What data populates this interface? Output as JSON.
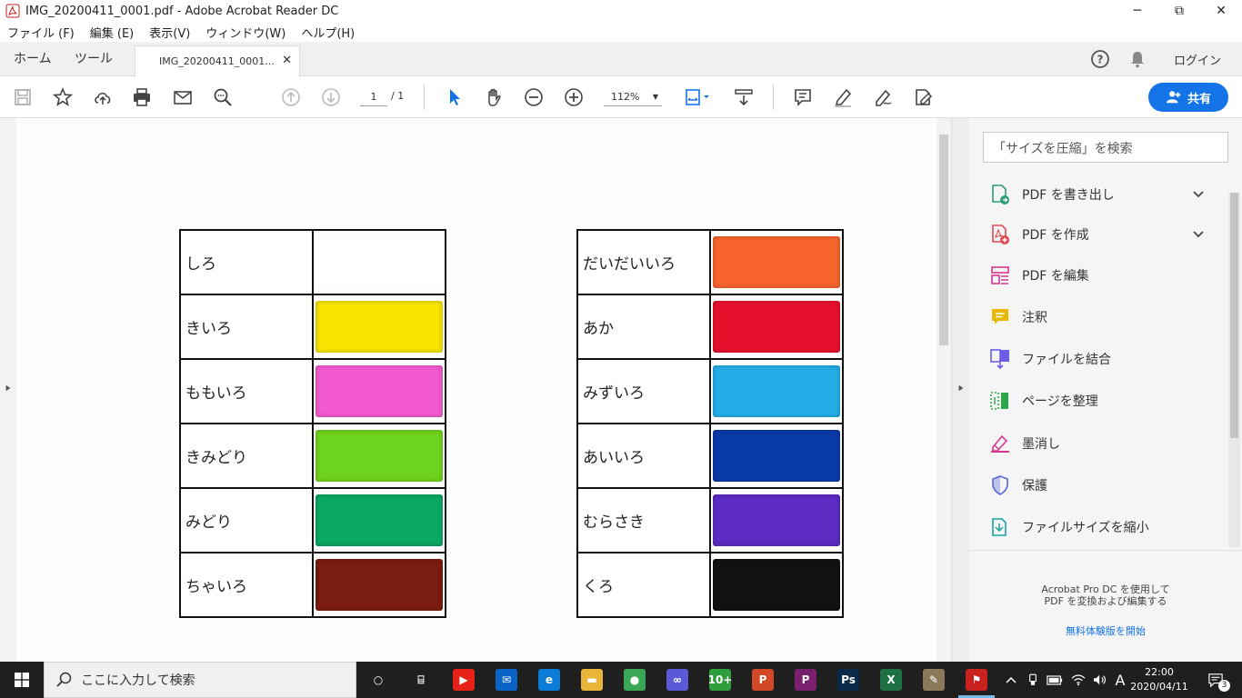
{
  "window": {
    "title": "IMG_20200411_0001.pdf - Adobe Acrobat Reader DC",
    "minimize": "─",
    "maximize": "⧉",
    "close": "✕"
  },
  "menu": [
    "ファイル (F)",
    "編集 (E)",
    "表示(V)",
    "ウィンドウ(W)",
    "ヘルプ(H)"
  ],
  "tabs": {
    "home": "ホーム",
    "tools": "ツール",
    "document": "IMG_20200411_0001...",
    "close": "✕",
    "login": "ログイン"
  },
  "toolbar": {
    "page_current": "1",
    "page_total": "/ 1",
    "zoom": "112%",
    "share_label": "共有"
  },
  "right_panel": {
    "search_placeholder": "「サイズを圧縮」を検索",
    "tools": [
      {
        "label": "PDF を書き出し",
        "icon": "export-pdf-icon",
        "color": "#2d9d78"
      },
      {
        "label": "PDF を作成",
        "icon": "create-pdf-icon",
        "color": "#e34850"
      },
      {
        "label": "PDF を編集",
        "icon": "edit-pdf-icon",
        "color": "#d83790"
      },
      {
        "label": "注釈",
        "icon": "comment-icon",
        "color": "#e8b900"
      },
      {
        "label": "ファイルを結合",
        "icon": "combine-files-icon",
        "color": "#6c5ce7"
      },
      {
        "label": "ページを整理",
        "icon": "organize-pages-icon",
        "color": "#2ba84a"
      },
      {
        "label": "墨消し",
        "icon": "redact-icon",
        "color": "#d83790"
      },
      {
        "label": "保護",
        "icon": "protect-icon",
        "color": "#5a66d6"
      },
      {
        "label": "ファイルサイズを縮小",
        "icon": "compress-icon",
        "color": "#17a2a0"
      }
    ],
    "promo_line1": "Acrobat Pro DC を使用して",
    "promo_line2": "PDF を変換および編集する",
    "promo_link": "無料体験版を開始"
  },
  "document": {
    "left_table": [
      {
        "label": "しろ",
        "color": "#ffffff"
      },
      {
        "label": "きいろ",
        "color": "#f7e400"
      },
      {
        "label": "ももいろ",
        "color": "#f35ad0"
      },
      {
        "label": "きみどり",
        "color": "#6fd41d"
      },
      {
        "label": "みどり",
        "color": "#0ba862"
      },
      {
        "label": "ちゃいろ",
        "color": "#7b1c10"
      }
    ],
    "right_table": [
      {
        "label": "だいだいいろ",
        "color": "#f7642c"
      },
      {
        "label": "あか",
        "color": "#e8112d"
      },
      {
        "label": "みずいろ",
        "color": "#23ade6"
      },
      {
        "label": "あいいろ",
        "color": "#0a3aa8"
      },
      {
        "label": "むらさき",
        "color": "#5c2bc2"
      },
      {
        "label": "くろ",
        "color": "#111111"
      }
    ]
  },
  "taskbar": {
    "search_placeholder": "ここに入力して検索",
    "time": "22:00",
    "date": "2020/04/11",
    "ime": "A",
    "notifications": "3",
    "apps": [
      {
        "icon": "task-view-icon",
        "label": "○",
        "color": "#1f1f1f"
      },
      {
        "icon": "timeline-icon",
        "label": "⌸",
        "color": "#1f1f1f"
      },
      {
        "icon": "youtube-icon",
        "label": "▶",
        "color": "#e62117"
      },
      {
        "icon": "mail-icon",
        "label": "✉",
        "color": "#0a64c8"
      },
      {
        "icon": "edge-icon",
        "label": "e",
        "color": "#0a7bd7"
      },
      {
        "icon": "explorer-icon",
        "label": "▬",
        "color": "#e8b43a"
      },
      {
        "icon": "chrome-icon",
        "label": "●",
        "color": "#3aa757"
      },
      {
        "icon": "infinity-icon",
        "label": "∞",
        "color": "#5a5ad6"
      },
      {
        "icon": "calendar-10-icon",
        "label": "10+",
        "color": "#2d9e3a"
      },
      {
        "icon": "powerpoint-icon",
        "label": "P",
        "color": "#d24726"
      },
      {
        "icon": "publisher-like-icon",
        "label": "P",
        "color": "#7a1f6e"
      },
      {
        "icon": "photoshop-icon",
        "label": "Ps",
        "color": "#0a2a4a"
      },
      {
        "icon": "excel-icon",
        "label": "X",
        "color": "#1e7145"
      },
      {
        "icon": "paint-icon",
        "label": "✎",
        "color": "#8a7a5a"
      },
      {
        "icon": "acrobat-icon",
        "label": "⚑",
        "color": "#c9211e"
      }
    ]
  }
}
